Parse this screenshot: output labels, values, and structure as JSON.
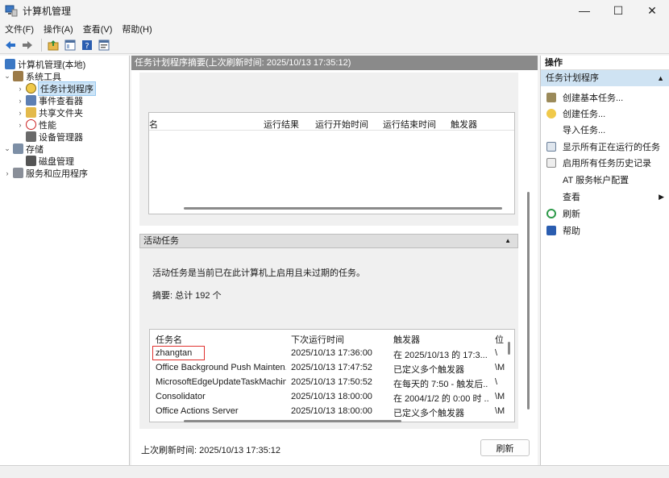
{
  "window": {
    "title": "计算机管理",
    "minimize": "—",
    "maximize": "☐",
    "close": "✕"
  },
  "menu": [
    "文件(F)",
    "操作(A)",
    "查看(V)",
    "帮助(H)"
  ],
  "tree": {
    "root": "计算机管理(本地)",
    "system_tools": "系统工具",
    "task_scheduler": "任务计划程序",
    "event_viewer": "事件查看器",
    "shared_folders": "共享文件夹",
    "performance": "性能",
    "device_manager": "设备管理器",
    "storage": "存储",
    "disk_management": "磁盘管理",
    "services_apps": "服务和应用程序"
  },
  "center": {
    "header": "任务计划程序摘要(上次刷新时间: 2025/10/13 17:35:12)",
    "top_grid_cols": [
      "名",
      "运行结果",
      "运行开始时间",
      "运行结束时间",
      "触发器"
    ],
    "active_tasks_header": "活动任务",
    "active_desc": "活动任务是当前已在此计算机上启用且未过期的任务。",
    "summary": "摘要: 总计 192 个",
    "table": {
      "headers": [
        "任务名",
        "下次运行时间",
        "触发器",
        "位"
      ],
      "rows": [
        [
          "zhangtan",
          "2025/10/13 17:36:00",
          "在 2025/10/13 的 17:3...",
          "\\"
        ],
        [
          "Office Background Push Mainten...",
          "2025/10/13 17:47:52",
          "已定义多个触发器",
          "\\M"
        ],
        [
          "MicrosoftEdgeUpdateTaskMachin...",
          "2025/10/13 17:50:52",
          "在每天的 7:50 - 触发后...",
          "\\"
        ],
        [
          "Consolidator",
          "2025/10/13 18:00:00",
          "在 2004/1/2 的 0:00 时 ...",
          "\\M"
        ],
        [
          "Office Actions Server",
          "2025/10/13 18:00:00",
          "已定义多个触发器",
          "\\M"
        ]
      ]
    },
    "last_refresh": "上次刷新时间: 2025/10/13 17:35:12",
    "refresh_button": "刷新"
  },
  "actions": {
    "title": "操作",
    "section": "任务计划程序",
    "items": [
      "创建基本任务...",
      "创建任务...",
      "导入任务...",
      "显示所有正在运行的任务",
      "启用所有任务历史记录",
      "AT 服务帐户配置",
      "查看",
      "刷新",
      "帮助"
    ]
  }
}
